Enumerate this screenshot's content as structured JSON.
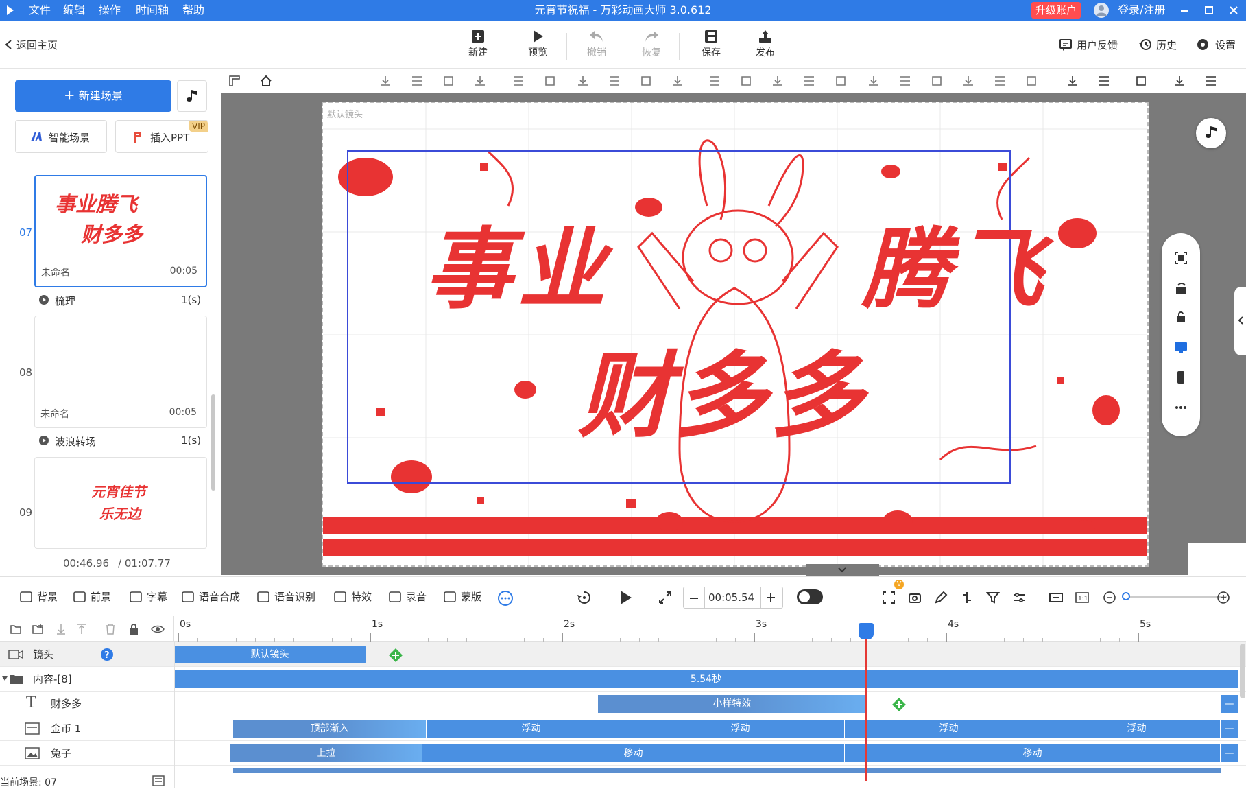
{
  "window": {
    "title": "元宵节祝福 - 万彩动画大师 3.0.612",
    "upgrade": "升级账户",
    "login": "登录/注册"
  },
  "menu": [
    "文件",
    "编辑",
    "操作",
    "时间轴",
    "帮助"
  ],
  "toolbar": {
    "back": "返回主页",
    "new": "新建",
    "preview": "预览",
    "undo": "撤销",
    "redo": "恢复",
    "save": "保存",
    "publish": "发布",
    "feedback": "用户反馈",
    "history": "历史",
    "settings": "设置"
  },
  "left": {
    "new_scene": "新建场景",
    "smart_scene": "智能场景",
    "insert_ppt": "插入PPT",
    "vip": "VIP",
    "scenes": [
      {
        "num": "07",
        "name": "未命名",
        "dur": "00:05",
        "thumb_line1": "事业腾飞",
        "thumb_line2": "财多多"
      },
      {
        "num": "08",
        "name": "未命名",
        "dur": "00:05"
      },
      {
        "num": "09",
        "thumb_line1": "元宵佳节",
        "thumb_line2": "乐无边"
      }
    ],
    "transitions": [
      {
        "name": "梳理",
        "dur": "1(s)"
      },
      {
        "name": "波浪转场",
        "dur": "1(s)"
      }
    ],
    "time_current": "00:46.96",
    "time_total": "/ 01:07.77"
  },
  "canvas": {
    "camera_label": "默认镜头",
    "line1a": "事业",
    "line1b": "腾飞",
    "line2": "财多多"
  },
  "bottom": {
    "items": [
      "背景",
      "前景",
      "字幕",
      "语音合成",
      "语音识别",
      "特效",
      "录音",
      "蒙版"
    ],
    "time": "00:05.54",
    "vbadge": "V"
  },
  "timeline": {
    "ticks": [
      "0s",
      "1s",
      "2s",
      "3s",
      "4s",
      "5s"
    ],
    "rows": [
      {
        "name": "镜头",
        "bars": [
          {
            "label": "默认镜头"
          }
        ]
      },
      {
        "name": "内容-[8]",
        "bars": [
          {
            "label": "5.54秒"
          }
        ]
      },
      {
        "name": "财多多",
        "bars": [
          {
            "label": "小样特效"
          }
        ]
      },
      {
        "name": "金币 1",
        "bars": [
          {
            "label": "顶部渐入"
          },
          {
            "label": "浮动"
          },
          {
            "label": "浮动"
          },
          {
            "label": "浮动"
          },
          {
            "label": "浮动"
          }
        ]
      },
      {
        "name": "兔子",
        "bars": [
          {
            "label": "上拉"
          },
          {
            "label": "移动"
          },
          {
            "label": "移动"
          }
        ]
      }
    ],
    "current_scene": "当前场景: 07"
  }
}
